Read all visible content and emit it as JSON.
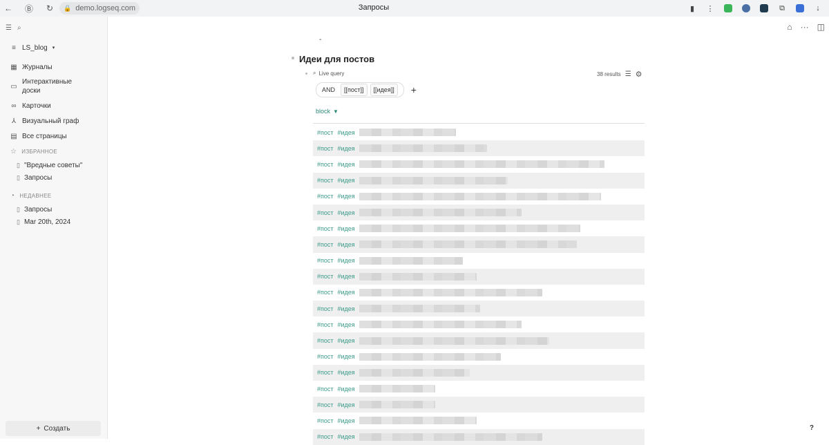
{
  "browser": {
    "url": "demo.logseq.com",
    "tab_title": "Запросы"
  },
  "sidebar": {
    "graph_name": "LS_blog",
    "nav": [
      {
        "label": "Журналы",
        "icon": "calendar-icon"
      },
      {
        "label": "Интерактивные доски",
        "icon": "whiteboard-icon"
      },
      {
        "label": "Карточки",
        "icon": "infinity-icon"
      },
      {
        "label": "Визуальный граф",
        "icon": "graph-icon"
      },
      {
        "label": "Все страницы",
        "icon": "pages-icon"
      }
    ],
    "favorites_title": "ИЗБРАННОЕ",
    "favorites": [
      "\"Вредные советы\"",
      "Запросы"
    ],
    "recent_title": "НЕДАВНЕЕ",
    "recent": [
      "Запросы",
      "Mar 20th, 2024"
    ],
    "create_label": "Создать"
  },
  "main": {
    "dash": "-",
    "block_title": "Идеи для постов",
    "live_query_label": "Live query",
    "results_count": "38 results",
    "filter": {
      "op": "AND",
      "tags": [
        "[[пост]]",
        "[[идея]]"
      ],
      "plus": "+"
    },
    "column_header": "block",
    "tag1": "#пост",
    "tag2": "#идея",
    "help": "?"
  }
}
